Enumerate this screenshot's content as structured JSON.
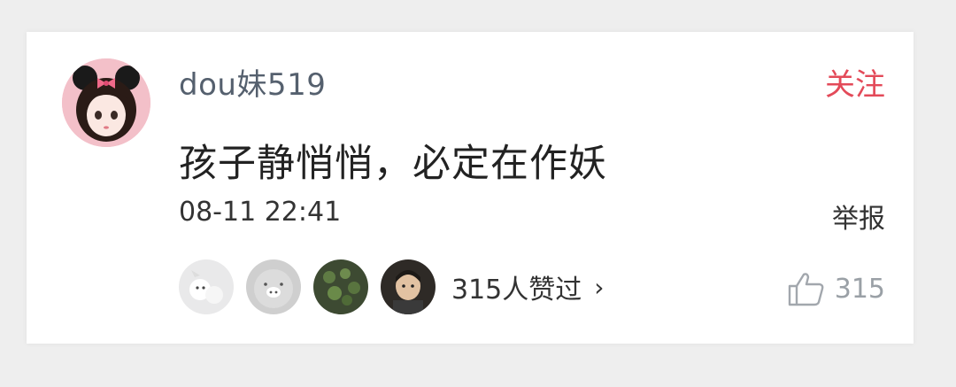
{
  "comment": {
    "username": "dou妹519",
    "follow_label": "关注",
    "text": "孩子静悄悄，必定在作妖",
    "timestamp": "08-11 22:41",
    "report_label": "举报",
    "likes_summary": "315人赞过",
    "like_count": "315"
  },
  "colors": {
    "accent": "#e34a59",
    "username": "#55606e",
    "muted": "#9aa0a6"
  }
}
